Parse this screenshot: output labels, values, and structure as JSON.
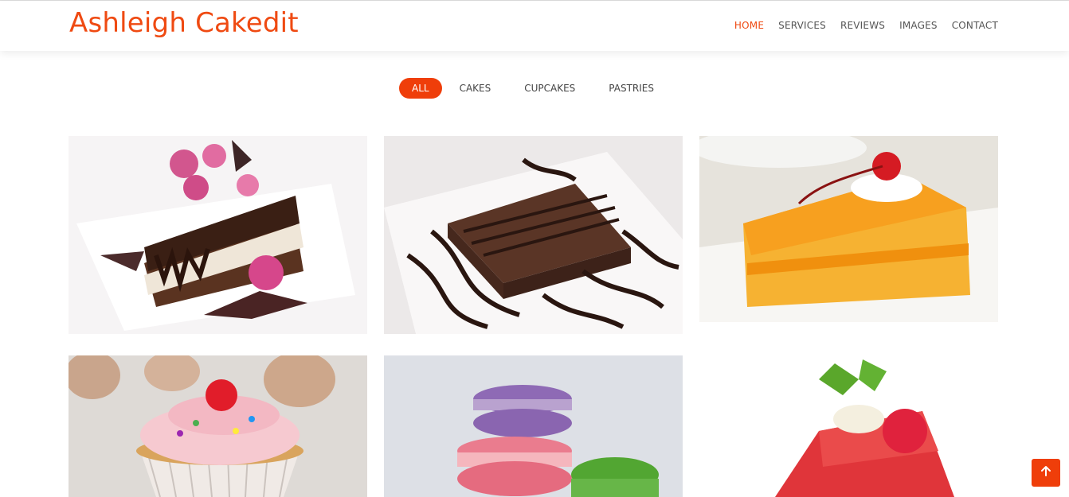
{
  "brand": {
    "name": "Ashleigh Cakedit",
    "color": "#ef4a12"
  },
  "nav": {
    "items": [
      {
        "label": "HOME",
        "active": true
      },
      {
        "label": "SERVICES",
        "active": false
      },
      {
        "label": "REVIEWS",
        "active": false
      },
      {
        "label": "IMAGES",
        "active": false
      },
      {
        "label": "CONTACT",
        "active": false
      }
    ]
  },
  "filters": [
    {
      "label": "ALL",
      "active": true
    },
    {
      "label": "CAKES",
      "active": false
    },
    {
      "label": "CUPCAKES",
      "active": false
    },
    {
      "label": "PASTRIES",
      "active": false
    }
  ],
  "gallery": [
    {
      "subject": "chocolate-cake-with-roses"
    },
    {
      "subject": "chocolate-brownie-with-drizzle"
    },
    {
      "subject": "orange-sponge-cake-with-cherry"
    },
    {
      "subject": "pink-frosted-cupcake"
    },
    {
      "subject": "macarons-stack"
    },
    {
      "subject": "raspberry-cheesecake-slice"
    }
  ],
  "scroll_top_icon": "arrow-up-icon",
  "accent_color": "#ef3e0a"
}
